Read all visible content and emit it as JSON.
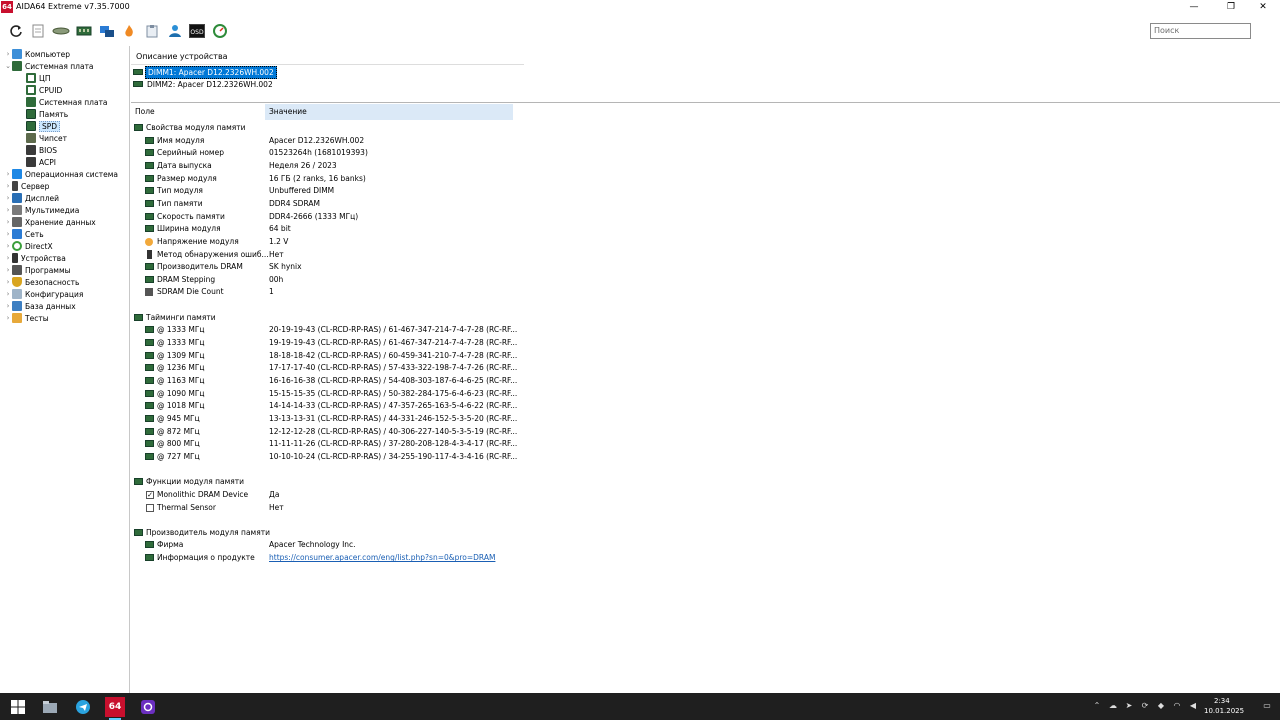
{
  "window": {
    "logo_text": "64",
    "title": "AIDA64 Extreme v7.35.7000",
    "minimize_glyph": "—",
    "maximize_glyph": "❐",
    "close_glyph": "✕"
  },
  "toolbar": {
    "search_placeholder": "Поиск",
    "osd_label": "OSD"
  },
  "tree": {
    "items": [
      {
        "label": "Компьютер",
        "icon": "computer-icon"
      },
      {
        "label": "Системная плата",
        "icon": "motherboard-icon"
      },
      {
        "label": "ЦП",
        "icon": "cpu-icon"
      },
      {
        "label": "CPUID",
        "icon": "cpuid-icon"
      },
      {
        "label": "Системная плата",
        "icon": "motherboard-icon"
      },
      {
        "label": "Память",
        "icon": "memory-icon"
      },
      {
        "label": "SPD",
        "icon": "spd-icon"
      },
      {
        "label": "Чипсет",
        "icon": "chipset-icon"
      },
      {
        "label": "BIOS",
        "icon": "bios-icon"
      },
      {
        "label": "ACPI",
        "icon": "acpi-icon"
      },
      {
        "label": "Операционная система",
        "icon": "windows-icon"
      },
      {
        "label": "Сервер",
        "icon": "server-icon"
      },
      {
        "label": "Дисплей",
        "icon": "display-icon"
      },
      {
        "label": "Мультимедиа",
        "icon": "multimedia-icon"
      },
      {
        "label": "Хранение данных",
        "icon": "storage-icon"
      },
      {
        "label": "Сеть",
        "icon": "network-icon"
      },
      {
        "label": "DirectX",
        "icon": "directx-icon"
      },
      {
        "label": "Устройства",
        "icon": "devices-icon"
      },
      {
        "label": "Программы",
        "icon": "programs-icon"
      },
      {
        "label": "Безопасность",
        "icon": "security-icon"
      },
      {
        "label": "Конфигурация",
        "icon": "config-icon"
      },
      {
        "label": "База данных",
        "icon": "database-icon"
      },
      {
        "label": "Тесты",
        "icon": "tests-icon"
      }
    ]
  },
  "device_panel": {
    "header": "Описание устройства",
    "devices": [
      "DIMM1: Apacer D12.2326WH.002",
      "DIMM2: Apacer D12.2326WH.002"
    ]
  },
  "details": {
    "col_field": "Поле",
    "col_value": "Значение",
    "rows": [
      {
        "kind": "section",
        "field": "Свойства модуля памяти",
        "value": ""
      },
      {
        "kind": "item",
        "field": "Имя модуля",
        "value": "Apacer D12.2326WH.002"
      },
      {
        "kind": "item",
        "field": "Серийный номер",
        "value": "01523264h (1681019393)"
      },
      {
        "kind": "item",
        "field": "Дата выпуска",
        "value": "Неделя 26 / 2023"
      },
      {
        "kind": "item",
        "field": "Размер модуля",
        "value": "16 ГБ (2 ranks, 16 banks)"
      },
      {
        "kind": "item",
        "field": "Тип модуля",
        "value": "Unbuffered DIMM"
      },
      {
        "kind": "item",
        "field": "Тип памяти",
        "value": "DDR4 SDRAM"
      },
      {
        "kind": "item",
        "field": "Скорость памяти",
        "value": "DDR4-2666 (1333 МГц)"
      },
      {
        "kind": "item",
        "field": "Ширина модуля",
        "value": "64 bit"
      },
      {
        "kind": "item",
        "field": "Напряжение модуля",
        "value": "1.2 V",
        "icon": "voltage"
      },
      {
        "kind": "item",
        "field": "Метод обнаружения ошиб...",
        "value": "Нет",
        "icon": "device"
      },
      {
        "kind": "item",
        "field": "Производитель DRAM",
        "value": "SK hynix"
      },
      {
        "kind": "item",
        "field": "DRAM Stepping",
        "value": "00h"
      },
      {
        "kind": "item",
        "field": "SDRAM Die Count",
        "value": "1",
        "icon": "die"
      },
      {
        "kind": "section",
        "field": "Тайминги памяти",
        "value": ""
      },
      {
        "kind": "item",
        "field": "@ 1333 МГц",
        "value": "20-19-19-43  (CL-RCD-RP-RAS) / 61-467-347-214-7-4-7-28  (RC-RF..."
      },
      {
        "kind": "item",
        "field": "@ 1333 МГц",
        "value": "19-19-19-43  (CL-RCD-RP-RAS) / 61-467-347-214-7-4-7-28  (RC-RF..."
      },
      {
        "kind": "item",
        "field": "@ 1309 МГц",
        "value": "18-18-18-42  (CL-RCD-RP-RAS) / 60-459-341-210-7-4-7-28  (RC-RF..."
      },
      {
        "kind": "item",
        "field": "@ 1236 МГц",
        "value": "17-17-17-40  (CL-RCD-RP-RAS) / 57-433-322-198-7-4-7-26  (RC-RF..."
      },
      {
        "kind": "item",
        "field": "@ 1163 МГц",
        "value": "16-16-16-38  (CL-RCD-RP-RAS) / 54-408-303-187-6-4-6-25  (RC-RF..."
      },
      {
        "kind": "item",
        "field": "@ 1090 МГц",
        "value": "15-15-15-35  (CL-RCD-RP-RAS) / 50-382-284-175-6-4-6-23  (RC-RF..."
      },
      {
        "kind": "item",
        "field": "@ 1018 МГц",
        "value": "14-14-14-33  (CL-RCD-RP-RAS) / 47-357-265-163-5-4-6-22  (RC-RF..."
      },
      {
        "kind": "item",
        "field": "@ 945 МГц",
        "value": "13-13-13-31  (CL-RCD-RP-RAS) / 44-331-246-152-5-3-5-20  (RC-RF..."
      },
      {
        "kind": "item",
        "field": "@ 872 МГц",
        "value": "12-12-12-28  (CL-RCD-RP-RAS) / 40-306-227-140-5-3-5-19  (RC-RF..."
      },
      {
        "kind": "item",
        "field": "@ 800 МГц",
        "value": "11-11-11-26  (CL-RCD-RP-RAS) / 37-280-208-128-4-3-4-17  (RC-RF..."
      },
      {
        "kind": "item",
        "field": "@ 727 МГц",
        "value": "10-10-10-24  (CL-RCD-RP-RAS) / 34-255-190-117-4-3-4-16  (RC-RF..."
      },
      {
        "kind": "section",
        "field": "Функции модуля памяти",
        "value": ""
      },
      {
        "kind": "check",
        "field": "Monolithic DRAM Device",
        "value": "Да",
        "checked": true
      },
      {
        "kind": "check",
        "field": "Thermal Sensor",
        "value": "Нет",
        "checked": false
      },
      {
        "kind": "section",
        "field": "Производитель модуля памяти",
        "value": ""
      },
      {
        "kind": "item",
        "field": "Фирма",
        "value": "Apacer Technology Inc."
      },
      {
        "kind": "link",
        "field": "Информация о продукте",
        "value": "https://consumer.apacer.com/eng/list.php?sn=0&pro=DRAM"
      }
    ]
  },
  "taskbar": {
    "aida_label": "64",
    "time": "2:34",
    "date": "10.01.2025"
  },
  "colors": {
    "accent": "#0078d7",
    "header_bg": "#dbe9f7",
    "ram_green": "#2f6b3a",
    "logo_red": "#c8102e",
    "taskbar": "#1f1f1f"
  }
}
